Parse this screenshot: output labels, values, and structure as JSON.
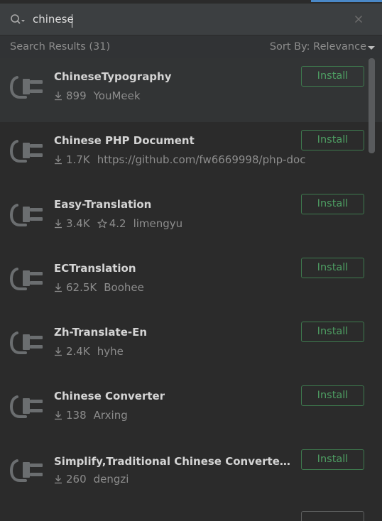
{
  "search": {
    "value": "chinese"
  },
  "results": {
    "count_label": "Search Results (31)",
    "sort_label": "Sort By: Relevance"
  },
  "plugins": [
    {
      "name": "ChineseTypography",
      "downloads": "899",
      "author": "YouMeek",
      "install_label": "Install"
    },
    {
      "name": "Chinese PHP Document",
      "downloads": "1.7K",
      "author": "https://github.com/fw6669998/php-doc",
      "install_label": "Install"
    },
    {
      "name": "Easy-Translation",
      "downloads": "3.4K",
      "rating": "4.2",
      "author": "limengyu",
      "install_label": "Install"
    },
    {
      "name": "ECTranslation",
      "downloads": "62.5K",
      "author": "Boohee",
      "install_label": "Install"
    },
    {
      "name": "Zh-Translate-En",
      "downloads": "2.4K",
      "author": "hyhe",
      "install_label": "Install"
    },
    {
      "name": "Chinese Converter",
      "downloads": "138",
      "author": "Arxing",
      "install_label": "Install"
    },
    {
      "name": "Simplify,Traditional Chinese Converter(简繁...",
      "downloads": "260",
      "author": "dengzi",
      "install_label": "Install"
    }
  ],
  "colors": {
    "background": "#2b2b2b",
    "install_accent": "#4e9e63",
    "scrollbar": "#595b5d"
  },
  "icons": {
    "search": "search-icon",
    "clear": "close-icon",
    "plugin": "plugin-plug-icon",
    "download": "download-icon",
    "rating": "star-icon",
    "sort": "chevron-down-icon"
  }
}
